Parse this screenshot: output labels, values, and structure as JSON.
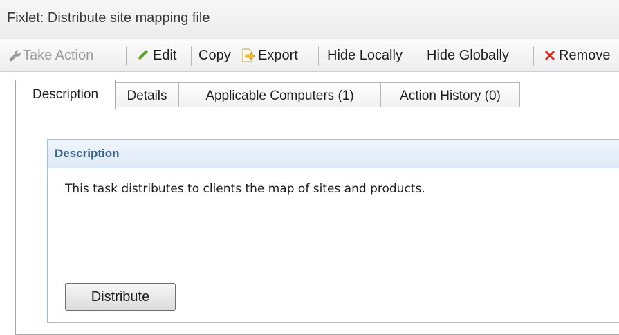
{
  "window": {
    "title": "Fixlet: Distribute site mapping file"
  },
  "toolbar": {
    "take_action": {
      "label": "Take Action",
      "icon": "wrench-icon",
      "disabled": true
    },
    "edit": {
      "label": "Edit",
      "icon": "pencil-icon"
    },
    "copy": {
      "label": "Copy"
    },
    "export": {
      "label": "Export",
      "icon": "export-icon"
    },
    "hide_locally": {
      "label": "Hide Locally"
    },
    "hide_globally": {
      "label": "Hide Globally"
    },
    "remove": {
      "label": "Remove",
      "icon": "red-x-icon"
    }
  },
  "tabs": [
    {
      "label": "Description",
      "active": true
    },
    {
      "label": "Details",
      "active": false
    },
    {
      "label": "Applicable Computers (1)",
      "active": false
    },
    {
      "label": "Action History (0)",
      "active": false
    }
  ],
  "description": {
    "header": "Description",
    "body": "This task distributes to clients the map of sites and products.",
    "button_label": "Distribute"
  },
  "colors": {
    "panel_header_text": "#3b5f87",
    "panel_border": "#9fc0dc",
    "remove_icon": "#d9261c",
    "edit_icon": "#5aa02c"
  }
}
